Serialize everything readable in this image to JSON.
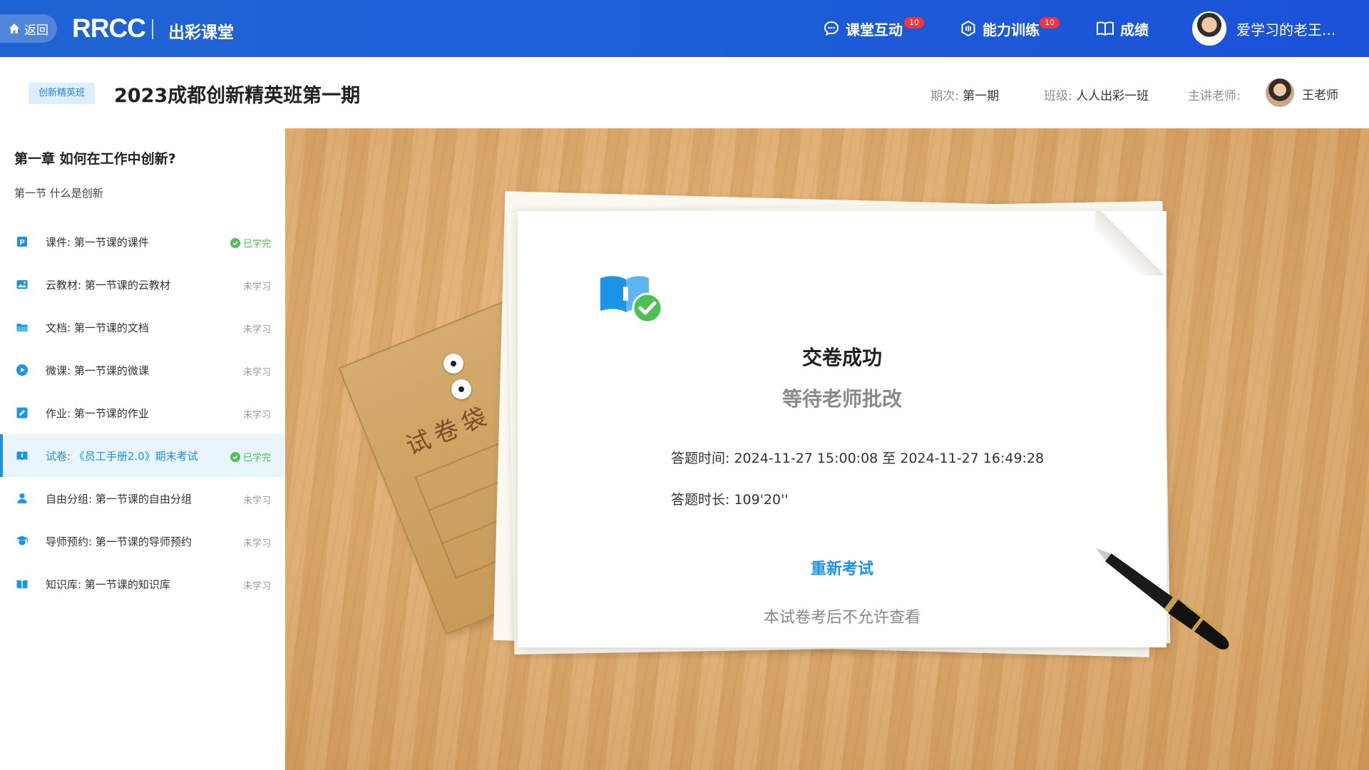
{
  "topbar": {
    "back_label": "返回",
    "logo_text": "RRCC",
    "brand_subtitle": "出彩课堂",
    "nav": [
      {
        "label": "课堂互动",
        "badge": "10"
      },
      {
        "label": "能力训练",
        "badge": "10"
      },
      {
        "label": "成绩",
        "badge": ""
      }
    ],
    "user_name": "爱学习的老王..."
  },
  "course": {
    "tag": "创新精英班",
    "title": "2023成都创新精英班第一期",
    "period_label": "期次:",
    "period_value": "第一期",
    "class_label": "班级:",
    "class_value": "人人出彩一班",
    "teacher_label": "主讲老师:",
    "teacher_name": "王老师"
  },
  "sidebar": {
    "chapter": "第一章  如何在工作中创新?",
    "section": "第一节  什么是创新",
    "items": [
      {
        "label": "课件: 第一节课的课件",
        "status": "已学完",
        "icon": "courseware-icon",
        "done": true
      },
      {
        "label": "云教材: 第一节课的云教材",
        "status": "未学习",
        "icon": "image-icon",
        "done": false
      },
      {
        "label": "文档: 第一节课的文档",
        "status": "未学习",
        "icon": "folder-icon",
        "done": false
      },
      {
        "label": "微课: 第一节课的微课",
        "status": "未学习",
        "icon": "play-icon",
        "done": false
      },
      {
        "label": "作业: 第一节课的作业",
        "status": "未学习",
        "icon": "edit-icon",
        "done": false
      },
      {
        "label": "试卷: 《员工手册2.0》期末考试",
        "status": "已学完",
        "icon": "exam-icon",
        "done": true
      },
      {
        "label": "自由分组: 第一节课的自由分组",
        "status": "未学习",
        "icon": "user-icon",
        "done": false
      },
      {
        "label": "导师预约: 第一节课的导师预约",
        "status": "未学习",
        "icon": "mentor-icon",
        "done": false
      },
      {
        "label": "知识库: 第一节课的知识库",
        "status": "未学习",
        "icon": "book-icon",
        "done": false
      }
    ]
  },
  "result": {
    "envelope_text": "试卷袋",
    "title": "交卷成功",
    "subtitle": "等待老师批改",
    "time_label": "答题时间:",
    "time_value": "2024-11-27 15:00:08 至 2024-11-27 16:49:28",
    "duration_label": "答题时长:",
    "duration_value": "109'20''",
    "retake_label": "重新考试",
    "note": "本试卷考后不允许查看"
  },
  "colors": {
    "primary": "#1b94e8",
    "topbar": "#1d5fd6",
    "done": "#4fbf58",
    "badge": "#f5333f",
    "desk": "#dba76a"
  }
}
